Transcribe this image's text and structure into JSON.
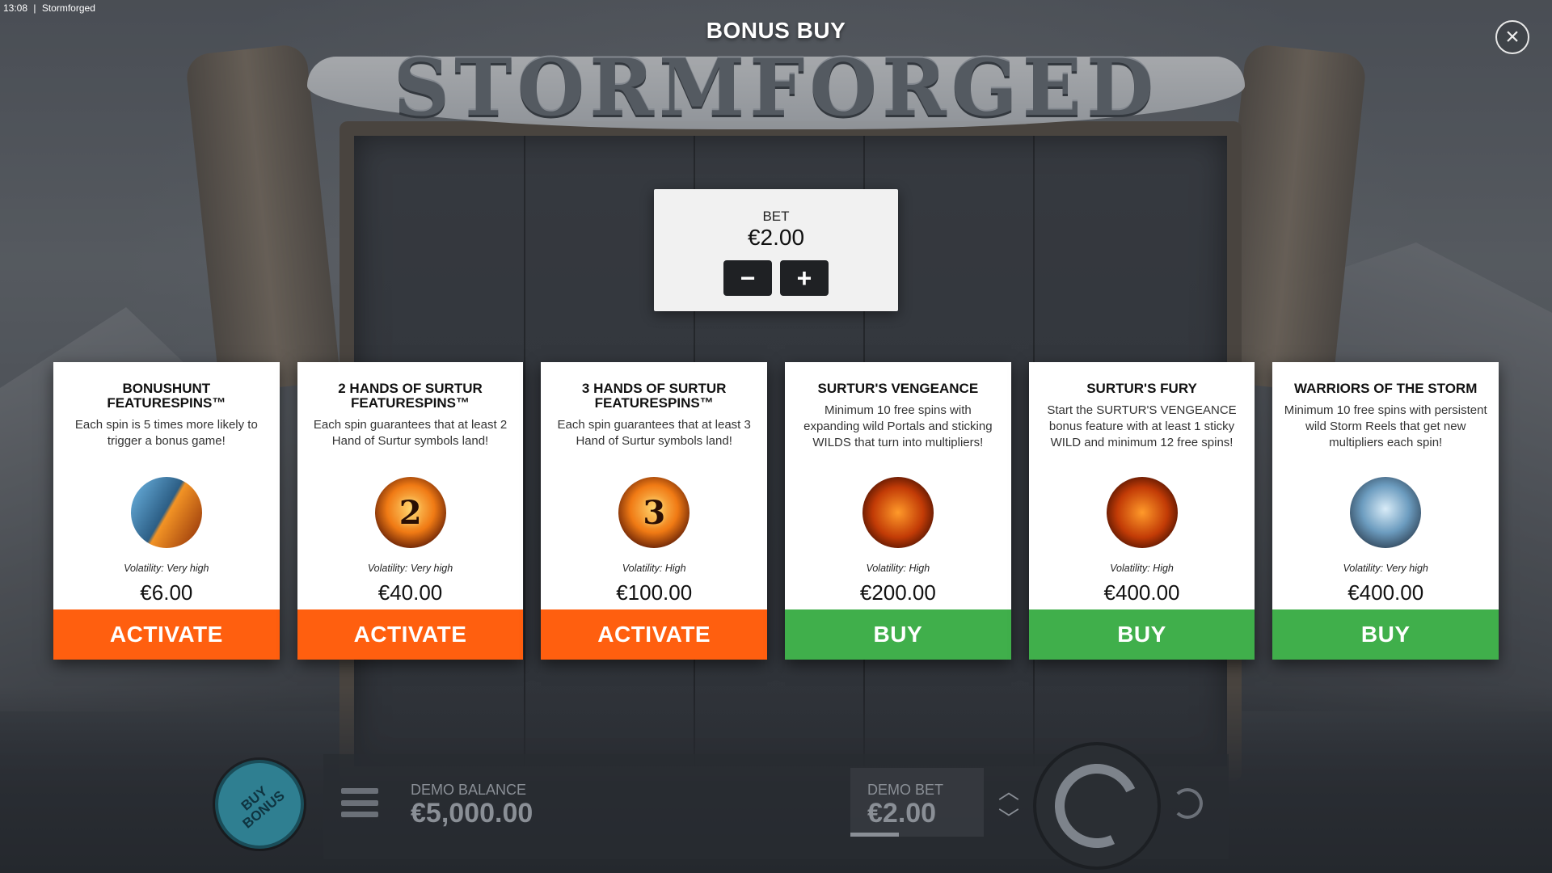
{
  "status": {
    "time": "13:08",
    "app_name": "Stormforged"
  },
  "header": {
    "title": "BONUS BUY",
    "logo": "STORMFORGED",
    "close_icon": "close-icon"
  },
  "bet": {
    "label": "BET",
    "value": "€2.00",
    "minus": "−",
    "plus": "+"
  },
  "cards": [
    {
      "title": "BONUSHUNT\nFEATURESPINS™",
      "description": "Each spin is 5 times more likely to trigger a bonus game!",
      "icon": "bonushunt-icon",
      "volatility": "Volatility: Very high",
      "price": "€6.00",
      "action": "ACTIVATE"
    },
    {
      "title": "2 HANDS OF SURTUR\nFEATURESPINS™",
      "description": "Each spin guarantees that at least 2 Hand of Surtur symbols land!",
      "icon": "two-hands-icon",
      "volatility": "Volatility: Very high",
      "price": "€40.00",
      "action": "ACTIVATE"
    },
    {
      "title": "3 HANDS OF SURTUR\nFEATURESPINS™",
      "description": "Each spin guarantees that at least 3 Hand of Surtur symbols land!",
      "icon": "three-hands-icon",
      "volatility": "Volatility: High",
      "price": "€100.00",
      "action": "ACTIVATE"
    },
    {
      "title": "SURTUR'S VENGEANCE",
      "description": "Minimum 10 free spins with expanding wild Portals and sticking WILDS that turn into multipliers!",
      "icon": "surtur-demon-icon",
      "volatility": "Volatility: High",
      "price": "€200.00",
      "action": "BUY"
    },
    {
      "title": "SURTUR'S FURY",
      "description": "Start the SURTUR'S VENGEANCE bonus feature with at least 1 sticky WILD and minimum 12 free spins!",
      "icon": "surtur-fury-icon",
      "volatility": "Volatility: High",
      "price": "€400.00",
      "action": "BUY"
    },
    {
      "title": "WARRIORS OF THE STORM",
      "description": "Minimum 10 free spins with persistent wild Storm Reels that get new multipliers each spin!",
      "icon": "storm-warrior-icon",
      "volatility": "Volatility: Very high",
      "price": "€400.00",
      "action": "BUY"
    }
  ],
  "bottom_bar": {
    "buy_bonus": "BUY\nBONUS",
    "balance_label": "DEMO BALANCE",
    "balance_value": "€5,000.00",
    "bet_label": "DEMO BET",
    "bet_value": "€2.00"
  },
  "colors": {
    "activate": "#ff5f0f",
    "buy": "#40af4b",
    "buy_bonus": "#2f7f91"
  }
}
